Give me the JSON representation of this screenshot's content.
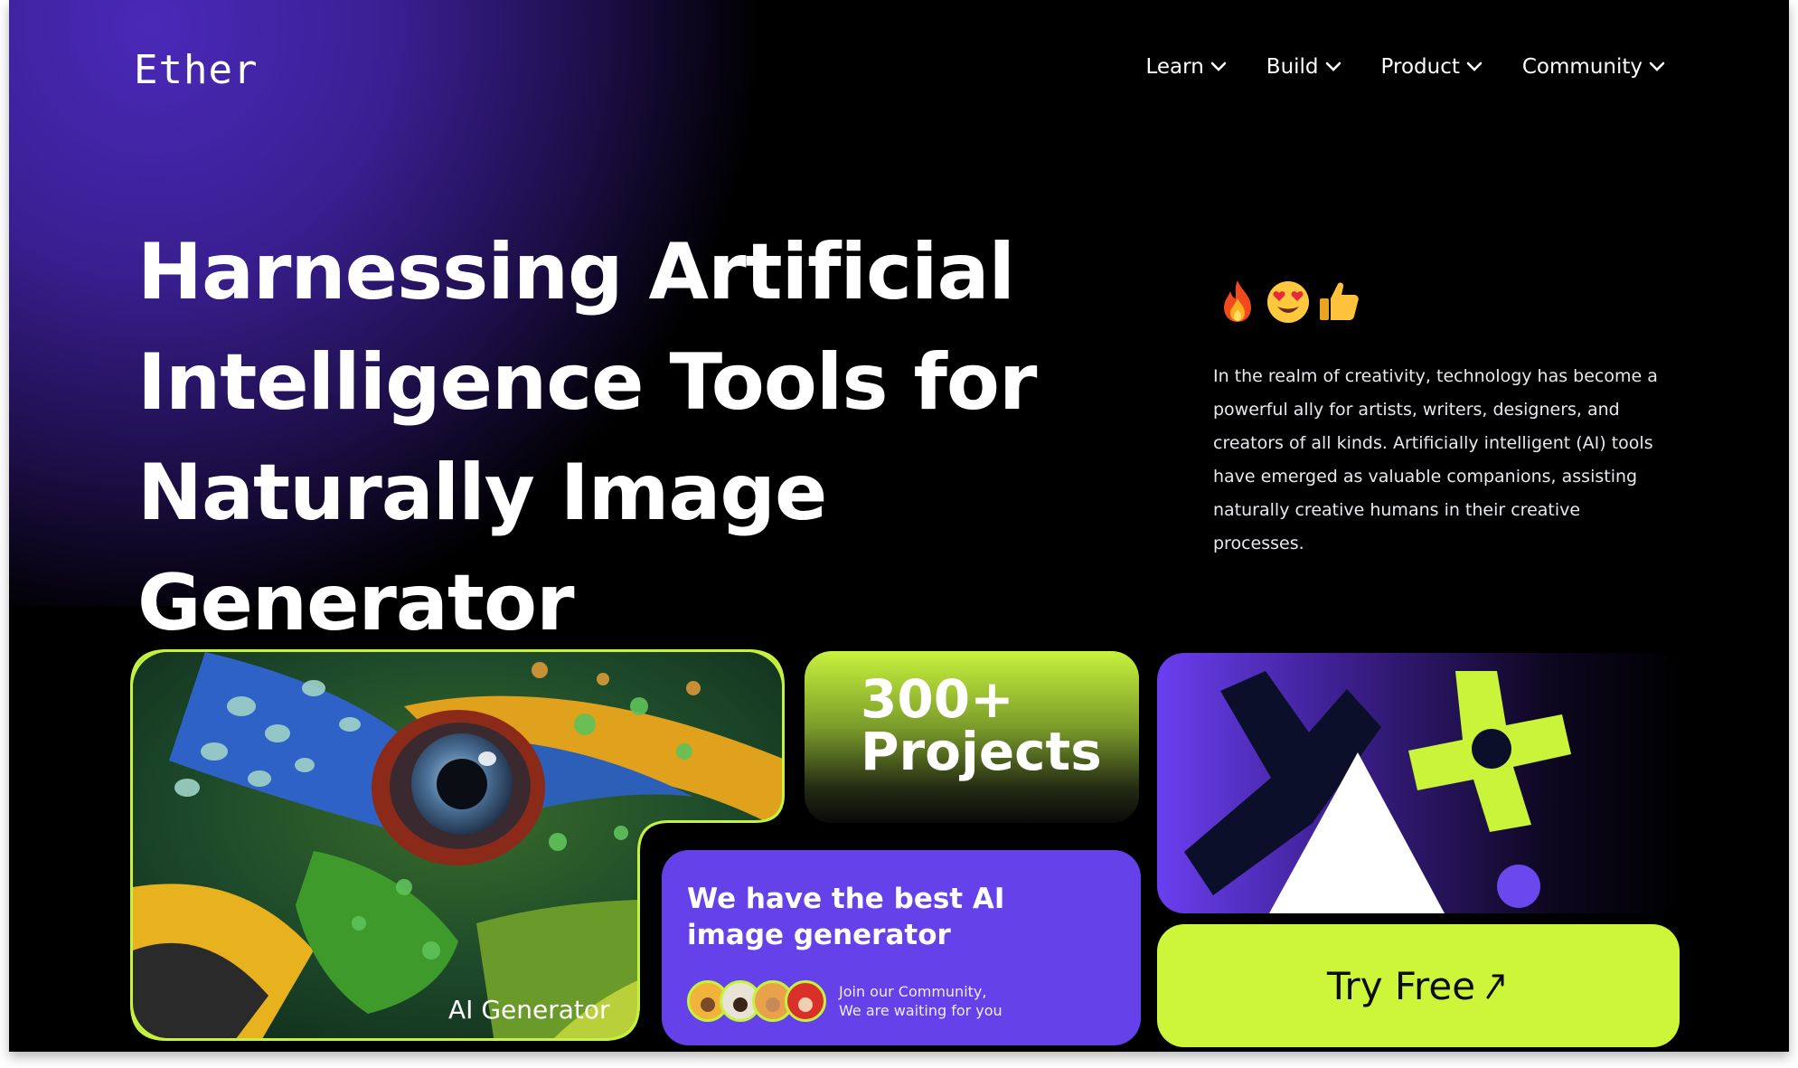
{
  "brand": {
    "logo": "Ether"
  },
  "nav": [
    {
      "label": "Learn"
    },
    {
      "label": "Build"
    },
    {
      "label": "Product"
    },
    {
      "label": "Community"
    }
  ],
  "hero": {
    "headline_lines": [
      "Harnessing Artificial",
      "Intelligence Tools for",
      "Naturally Image Generator"
    ],
    "emojis": [
      "fire-emoji",
      "heart-eyes-emoji",
      "thumbs-up-emoji"
    ],
    "description": "In the realm of creativity, technology has become a powerful ally for artists, writers, designers, and creators of all kinds. Artificially intelligent (AI) tools have emerged as valuable companions, assisting naturally creative humans in their creative processes."
  },
  "cards": {
    "image_card_label": "AI Generator",
    "projects_count": "300+",
    "projects_label": "Projects",
    "best_title": "We have the best AI image generator",
    "community_line1": "Join our Community,",
    "community_line2": "We are waiting for you",
    "try_label": "Try Free"
  },
  "colors": {
    "accent_lime": "#c4f23f",
    "accent_purple": "#6441e8",
    "background": "#000000"
  }
}
